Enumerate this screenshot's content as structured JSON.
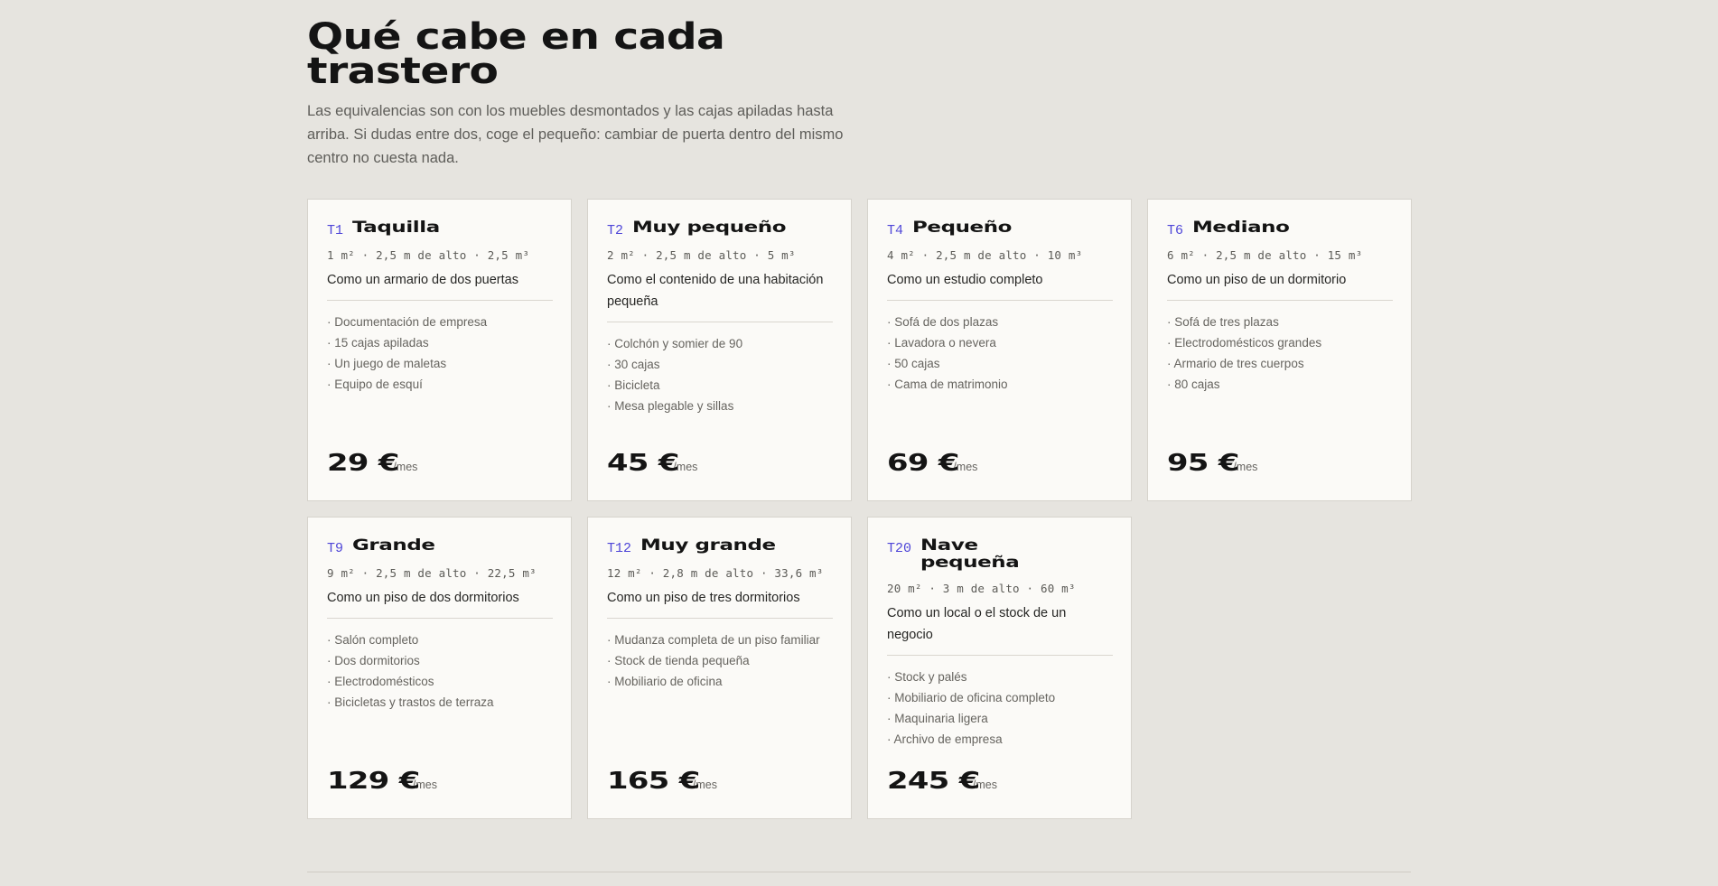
{
  "section": {
    "title": "Qué cabe en cada trastero",
    "intro": "Las equivalencias son con los muebles desmontados y las cajas apiladas hasta arriba. Si dudas entre dos, coge el pequeño: cambiar de puerta dentro del mismo centro no cuesta nada."
  },
  "colors": {
    "accent": "#4f46d8",
    "background": "#e6e4df",
    "card": "#fbfaf7"
  },
  "cards": [
    {
      "code": "T1",
      "name": "Taquilla",
      "specs": "1 m² · 2,5 m de alto · 2,5 m³",
      "equiv": "Como un armario de dos puertas",
      "items": [
        "Documentación de empresa",
        "15 cajas apiladas",
        "Un juego de maletas",
        "Equipo de esquí"
      ],
      "price": "29 €",
      "per": "/mes"
    },
    {
      "code": "T2",
      "name": "Muy pequeño",
      "specs": "2 m² · 2,5 m de alto · 5 m³",
      "equiv": "Como el contenido de una habitación pequeña",
      "items": [
        "Colchón y somier de 90",
        "30 cajas",
        "Bicicleta",
        "Mesa plegable y sillas"
      ],
      "price": "45 €",
      "per": "/mes"
    },
    {
      "code": "T4",
      "name": "Pequeño",
      "specs": "4 m² · 2,5 m de alto · 10 m³",
      "equiv": "Como un estudio completo",
      "items": [
        "Sofá de dos plazas",
        "Lavadora o nevera",
        "50 cajas",
        "Cama de matrimonio"
      ],
      "price": "69 €",
      "per": "/mes"
    },
    {
      "code": "T6",
      "name": "Mediano",
      "specs": "6 m² · 2,5 m de alto · 15 m³",
      "equiv": "Como un piso de un dormitorio",
      "items": [
        "Sofá de tres plazas",
        "Electrodomésticos grandes",
        "Armario de tres cuerpos",
        "80 cajas"
      ],
      "price": "95 €",
      "per": "/mes"
    },
    {
      "code": "T9",
      "name": "Grande",
      "specs": "9 m² · 2,5 m de alto · 22,5 m³",
      "equiv": "Como un piso de dos dormitorios",
      "items": [
        "Salón completo",
        "Dos dormitorios",
        "Electrodomésticos",
        "Bicicletas y trastos de terraza"
      ],
      "price": "129 €",
      "per": "/mes"
    },
    {
      "code": "T12",
      "name": "Muy grande",
      "specs": "12 m² · 2,8 m de alto · 33,6 m³",
      "equiv": "Como un piso de tres dormitorios",
      "items": [
        "Mudanza completa de un piso familiar",
        "Stock de tienda pequeña",
        "Mobiliario de oficina"
      ],
      "price": "165 €",
      "per": "/mes"
    },
    {
      "code": "T20",
      "name": "Nave pequeña",
      "specs": "20 m² · 3 m de alto · 60 m³",
      "equiv": "Como un local o el stock de un negocio",
      "items": [
        "Stock y palés",
        "Mobiliario de oficina completo",
        "Maquinaria ligera",
        "Archivo de empresa"
      ],
      "price": "245 €",
      "per": "/mes"
    }
  ]
}
